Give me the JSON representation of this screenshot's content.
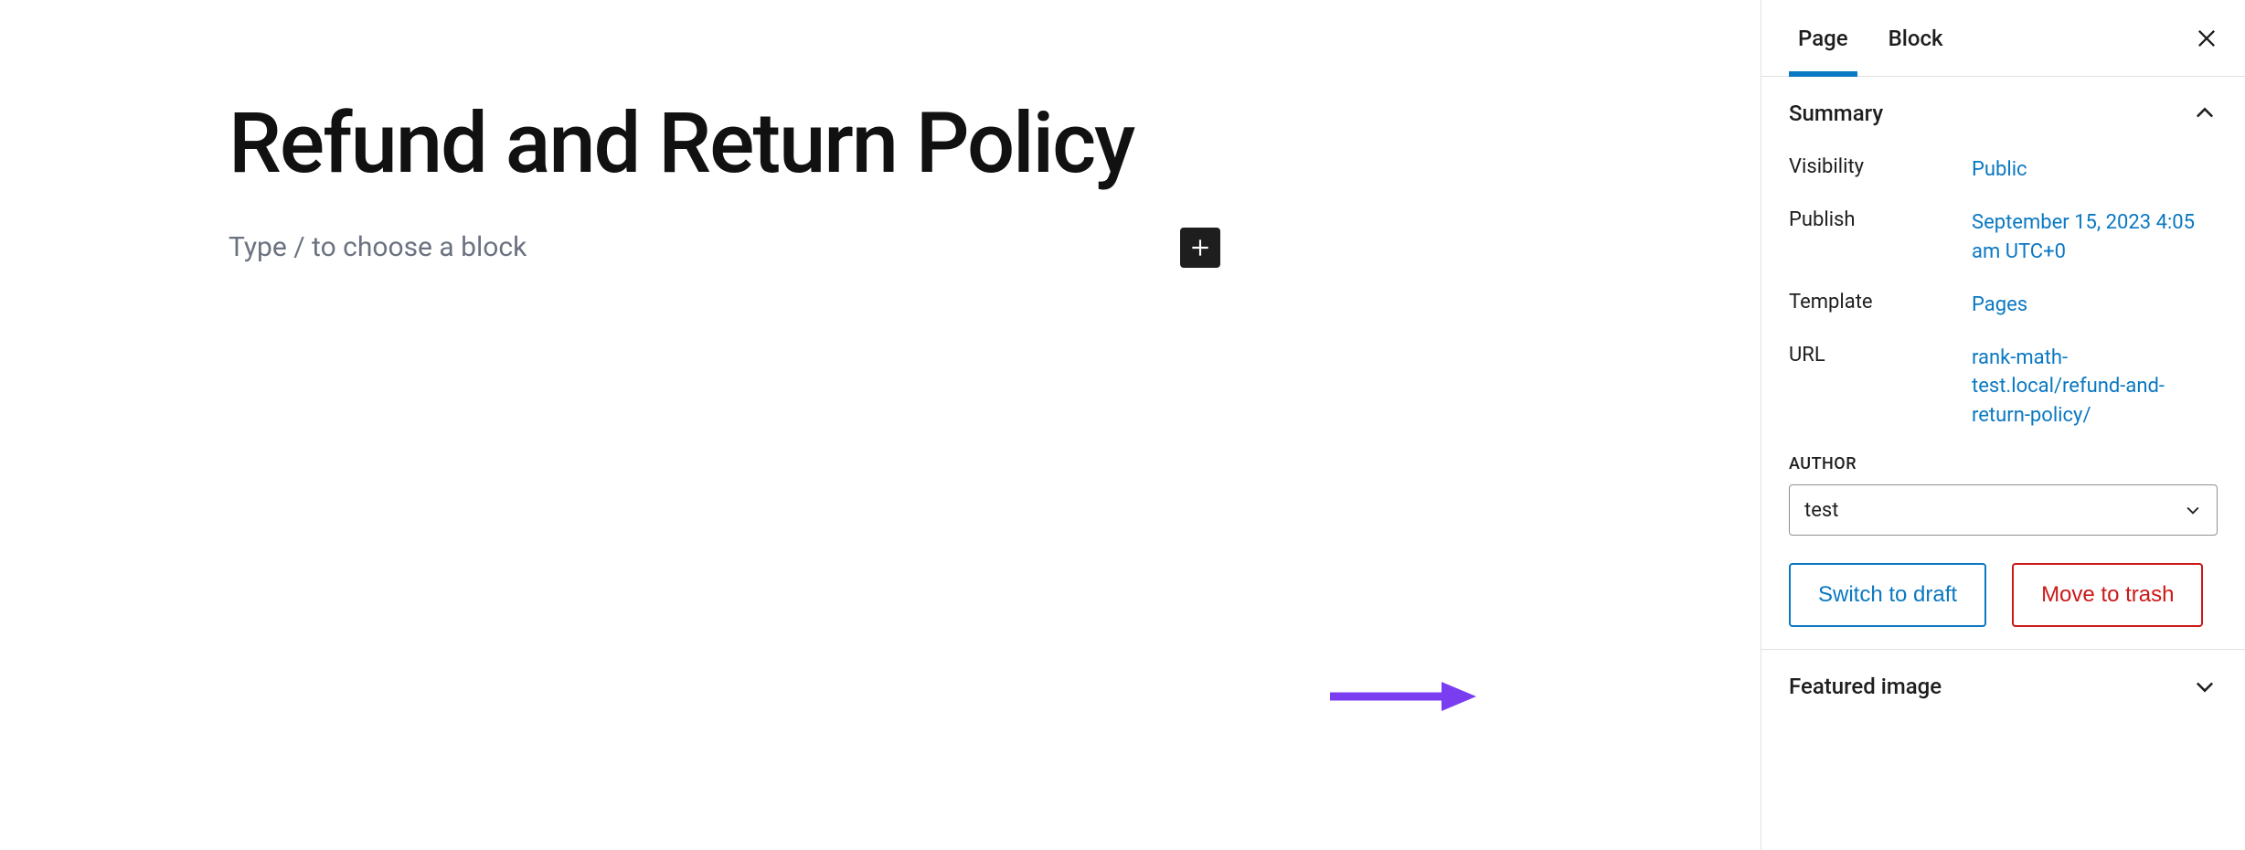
{
  "editor": {
    "title": "Refund and Return Policy",
    "placeholder": "Type / to choose a block"
  },
  "sidebar": {
    "tabs": {
      "page": "Page",
      "block": "Block",
      "active": "page"
    },
    "summary": {
      "heading": "Summary",
      "visibility": {
        "label": "Visibility",
        "value": "Public"
      },
      "publish": {
        "label": "Publish",
        "value": "September 15, 2023 4:05 am UTC+0"
      },
      "template": {
        "label": "Template",
        "value": "Pages"
      },
      "url": {
        "label": "URL",
        "value": "rank-math-test.local/refund-and-return-policy/"
      },
      "author": {
        "label": "AUTHOR",
        "value": "test"
      },
      "switch_draft": "Switch to draft",
      "move_trash": "Move to trash"
    },
    "featured_image": {
      "heading": "Featured image"
    }
  }
}
